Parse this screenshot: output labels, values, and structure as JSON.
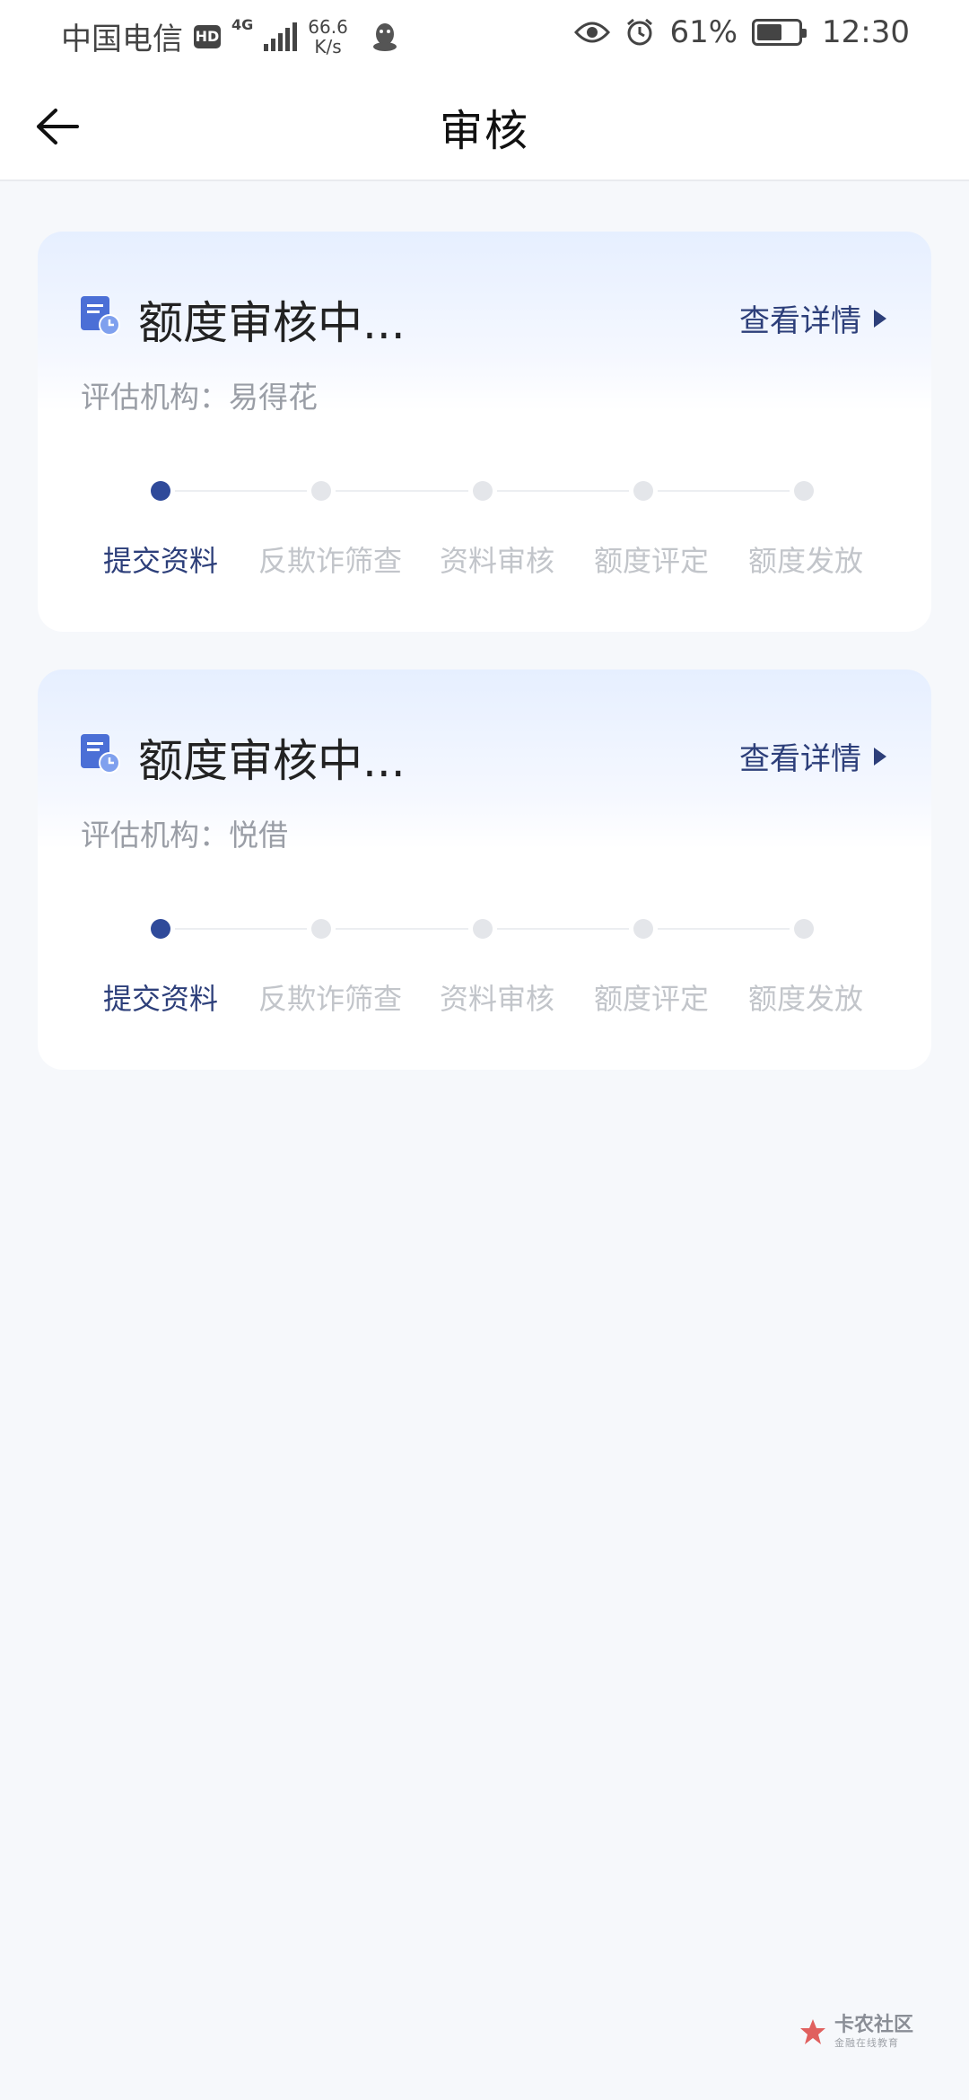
{
  "status_bar": {
    "carrier": "中国电信",
    "hd": "HD",
    "network_type": "4G",
    "speed_value": "66.6",
    "speed_unit": "K/s",
    "battery_percent": "61%",
    "battery_level": 0.61,
    "time": "12:30"
  },
  "header": {
    "title": "审核"
  },
  "cards": [
    {
      "title": "额度审核中...",
      "detail_label": "查看详情",
      "institution": "评估机构：易得花",
      "current_step": 0,
      "steps": [
        "提交资料",
        "反欺诈筛查",
        "资料审核",
        "额度评定",
        "额度发放"
      ]
    },
    {
      "title": "额度审核中...",
      "detail_label": "查看详情",
      "institution": "评估机构：悦借",
      "current_step": 0,
      "steps": [
        "提交资料",
        "反欺诈筛查",
        "资料审核",
        "额度评定",
        "额度发放"
      ]
    }
  ],
  "watermark": {
    "main": "卡农社区",
    "sub": "金融在线教育"
  },
  "colors": {
    "accent": "#2f4a9a",
    "link": "#2d3f7a",
    "inactive_dot": "#e4e6ea",
    "inactive_label": "#c2c5ca",
    "muted_text": "#9a9ea6"
  }
}
